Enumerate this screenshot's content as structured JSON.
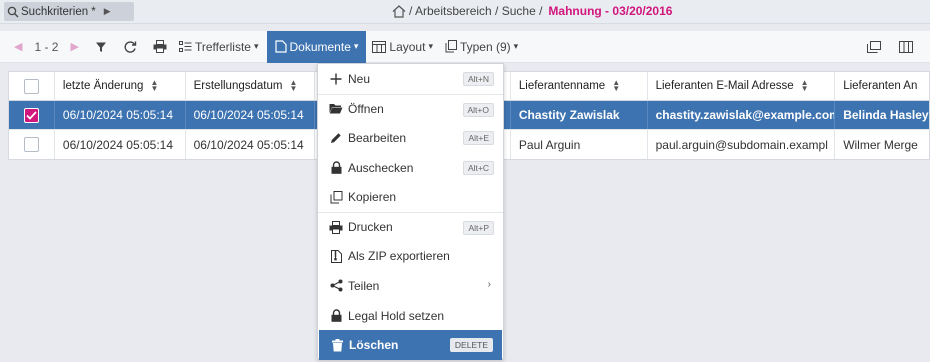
{
  "topbar": {
    "search_label": "Suchkriterien *",
    "breadcrumb_path": "/ Arbeitsbereich / Suche /",
    "breadcrumb_current": "Mahnung - 03/20/2016"
  },
  "toolbar": {
    "range": "1 - 2",
    "hitlist_label": "Trefferliste",
    "documents_label": "Dokumente",
    "layout_label": "Layout",
    "types_label": "Typen (9)"
  },
  "table": {
    "headers": [
      "letzte Änderung",
      "Erstellungsdatum",
      "",
      "Lieferantenname",
      "Lieferanten E-Mail Adresse",
      "Lieferanten An"
    ],
    "rows": [
      {
        "selected": true,
        "cells": [
          "06/10/2024 05:05:14",
          "06/10/2024 05:05:14",
          "",
          "Chastity Zawislak",
          "chastity.zawislak@example.com",
          "Belinda Hasley"
        ]
      },
      {
        "selected": false,
        "cells": [
          "06/10/2024 05:05:14",
          "06/10/2024 05:05:14",
          "",
          "Paul Arguin",
          "paul.arguin@subdomain.exampl",
          "Wilmer Merge"
        ]
      }
    ]
  },
  "menu": {
    "items": [
      {
        "label": "Neu",
        "shortcut": "Alt+N",
        "icon": "plus-icon"
      },
      {
        "label": "Öffnen",
        "shortcut": "Alt+O",
        "icon": "folder-open-icon"
      },
      {
        "label": "Bearbeiten",
        "shortcut": "Alt+E",
        "icon": "pencil-icon"
      },
      {
        "label": "Auschecken",
        "shortcut": "Alt+C",
        "icon": "lock-icon"
      },
      {
        "label": "Kopieren",
        "shortcut": "",
        "icon": "copy-icon"
      },
      {
        "label": "Drucken",
        "shortcut": "Alt+P",
        "icon": "printer-icon"
      },
      {
        "label": "Als ZIP exportieren",
        "shortcut": "",
        "icon": "zip-file-icon"
      },
      {
        "label": "Teilen",
        "shortcut": "",
        "icon": "share-icon"
      },
      {
        "label": "Legal Hold setzen",
        "shortcut": "",
        "icon": "lock-icon"
      },
      {
        "label": "Löschen",
        "shortcut": "DELETE",
        "icon": "trash-icon"
      }
    ]
  },
  "colors": {
    "accent_blue": "#3e73b1",
    "accent_magenta": "#d1167d",
    "background": "#e8eaef"
  }
}
